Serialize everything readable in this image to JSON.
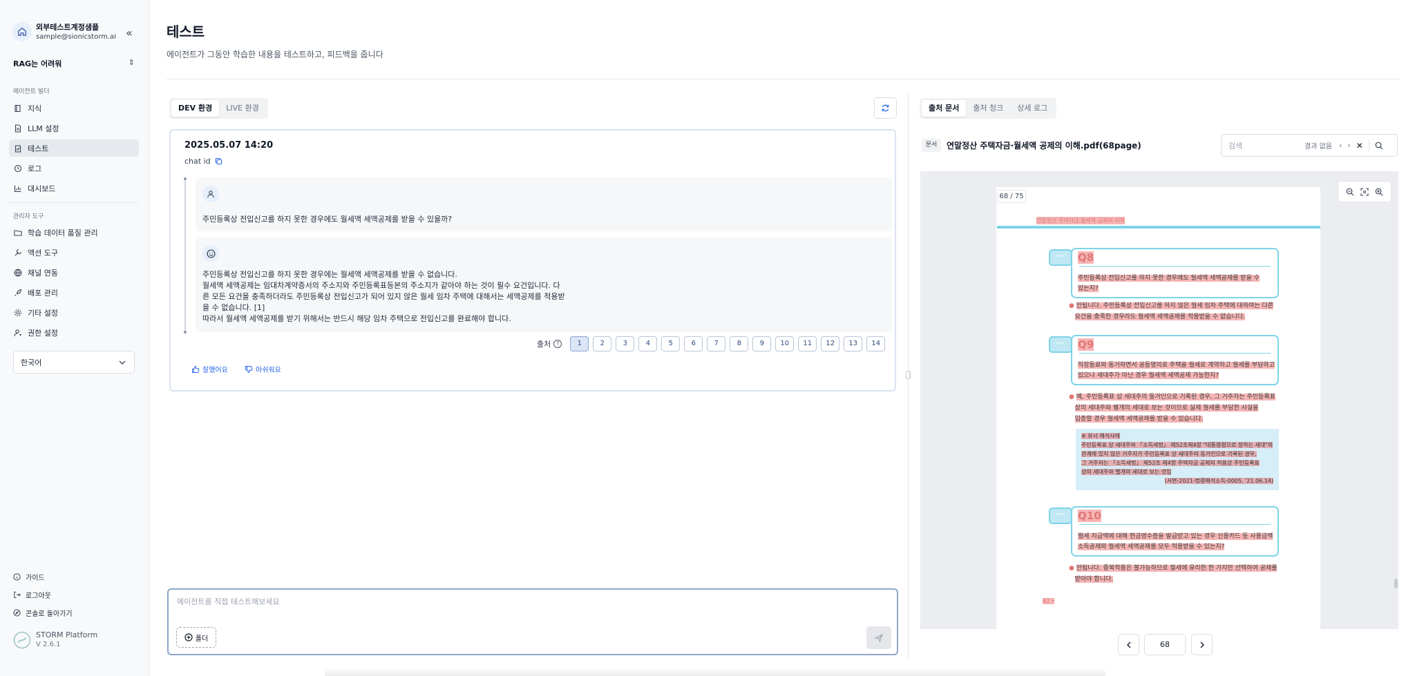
{
  "sidebar": {
    "account": {
      "name": "외부테스트계정샘플",
      "email": "sample@sionicstorm.ai"
    },
    "project": "RAG는 어려워",
    "builder_label": "에이전트 빌더",
    "builder_items": [
      {
        "label": "지식",
        "icon": "book-icon"
      },
      {
        "label": "LLM 설정",
        "icon": "document-icon"
      },
      {
        "label": "테스트",
        "icon": "clipboard-check-icon"
      },
      {
        "label": "로그",
        "icon": "history-icon"
      },
      {
        "label": "대시보드",
        "icon": "bar-chart-icon"
      }
    ],
    "admin_label": "관리자 도구",
    "admin_items": [
      {
        "label": "학습 데이터 품질 관리",
        "icon": "folder-search-icon"
      },
      {
        "label": "액션 도구",
        "icon": "wrench-icon"
      },
      {
        "label": "채널 연동",
        "icon": "globe-icon"
      },
      {
        "label": "배포 관리",
        "icon": "rocket-icon"
      },
      {
        "label": "기타 설정",
        "icon": "gear-icon"
      },
      {
        "label": "권한 설정",
        "icon": "user-key-icon"
      }
    ],
    "language": "한국어",
    "footer_items": [
      {
        "label": "가이드",
        "icon": "info-icon"
      },
      {
        "label": "로그아웃",
        "icon": "logout-icon"
      },
      {
        "label": "콘솔로 돌아가기",
        "icon": "compass-icon"
      }
    ],
    "platform": {
      "name": "STORM Platform",
      "version": "V 2.6.1"
    }
  },
  "header": {
    "title": "테스트",
    "subtitle": "에이전트가 그동안 학습한 내용을 테스트하고, 피드백을 줍니다"
  },
  "env_tabs": {
    "dev": "DEV 환경",
    "live": "LIVE 환경",
    "active": "dev"
  },
  "chat": {
    "date": "2025.05.07 14:20",
    "chat_id_label": "chat id",
    "question": "주민등록상 전입신고를 하지 못한 경우에도 월세액 세액공제를 받을 수 있을까?",
    "answer_lines": [
      "주민등록상 전입신고를 하지 못한 경우에는 월세액 세액공제를 받을 수 없습니다.",
      "월세액 세액공제는 임대차계약증서의 주소지와 주민등록표등본의 주소지가 같아야 하는 것이 필수 요건입니다. 다",
      "른 모든 요건을 충족하더라도 주민등록상 전입신고가 되어 있지 않은 월세 임차 주택에 대해서는 세액공제를 적용받",
      "을 수 없습니다. [1]",
      "따라서 월세액 세액공제를 받기 위해서는 반드시 해당 임차 주택으로 전입신고를 완료해야 합니다."
    ],
    "sources_label": "출처",
    "source_pages": [
      "1",
      "2",
      "3",
      "4",
      "5",
      "6",
      "7",
      "8",
      "9",
      "10",
      "11",
      "12",
      "13",
      "14"
    ],
    "selected_source": "1",
    "feedback_good": "잘했어요",
    "feedback_bad": "아쉬워요"
  },
  "input": {
    "placeholder": "에이전트를 직접 테스트해보세요",
    "folder_label": "폴더"
  },
  "right_tabs": {
    "sources": "출처 문서",
    "chunks": "출처 청크",
    "logs": "상세 로그",
    "active": "sources"
  },
  "document": {
    "tag": "문서",
    "title": "연말정산 주택자금·월세액 공제의 이해.pdf(68page)",
    "search_placeholder": "검색",
    "search_result": "결과 없음",
    "page_indicator": "68 / 75",
    "current_page": "68",
    "pdf": {
      "running_header": "연말정산 주택자금·월세액 공제의 이해",
      "q8_title": "Q8",
      "q8_text": [
        "주민등록상 전입신고를 하지 못한 경우에도 월세액 세액공제를 받을 수",
        "있는지?"
      ],
      "a8_text": [
        "안됩니다. 주민등록상 전입신고를 하지 않은 월세 임차 주택에 대하여는 다른",
        "요건을 충족한 경우라도 월세액 세액공제를 적용받을 수 없습니다."
      ],
      "q9_title": "Q9",
      "q9_text": [
        "직장동료와 동거하면서 공동명의로 주택을 월세로 계약하고 월세를 부담하고",
        "있으나 세대주가 아닌 경우 월세액 세액공제 가능한지?"
      ],
      "a9_text": [
        "예, 주민등록표 상 세대주의 동거인으로 기록된 경우, 그 거주자는 주민등록표",
        "상의 세대주와 별개의 세대로 보는 것이므로 실제 월세를 부담한 사실을",
        "입증할 경우 월세액 세액공제를 받을 수 있습니다."
      ],
      "example_lines": [
        "※ 유사 해석사례",
        "주민등록표 상 세대주와 「소득세법」 제52조제4항 \"대통령령으로 정하는 세대\"의",
        "관계에 있지 않은 거주자가 주민등록표 상 세대주의 동거인으로 기록된 경우,",
        "그 거주자는 「소득세법」 제52조 제4항 주택자금 공제의 적용상 주민등록표",
        "상의 세대주와 별개의 세대로 보는 것임",
        "(서면-2021-법령해석소득-0005, '21.06.14)"
      ],
      "q10_title": "Q10",
      "q10_text": [
        "월세 지급액에 대해 현금영수증을 발급받고 있는 경우 신용카드 등 사용금액",
        "소득공제와 월세액 세액공제를 모두 적용받을 수 있는지?"
      ],
      "a10_text": [
        "안됩니다. 중복적용은 불가능하므로 절세에 유리한 한 가지만 선택하여 공제를",
        "받아야 합니다."
      ],
      "page_footer": "62 •"
    }
  },
  "colors": {
    "accent": "#2563eb",
    "highlight": "#ef7878",
    "pdf_cyan": "#7dd3e8"
  }
}
